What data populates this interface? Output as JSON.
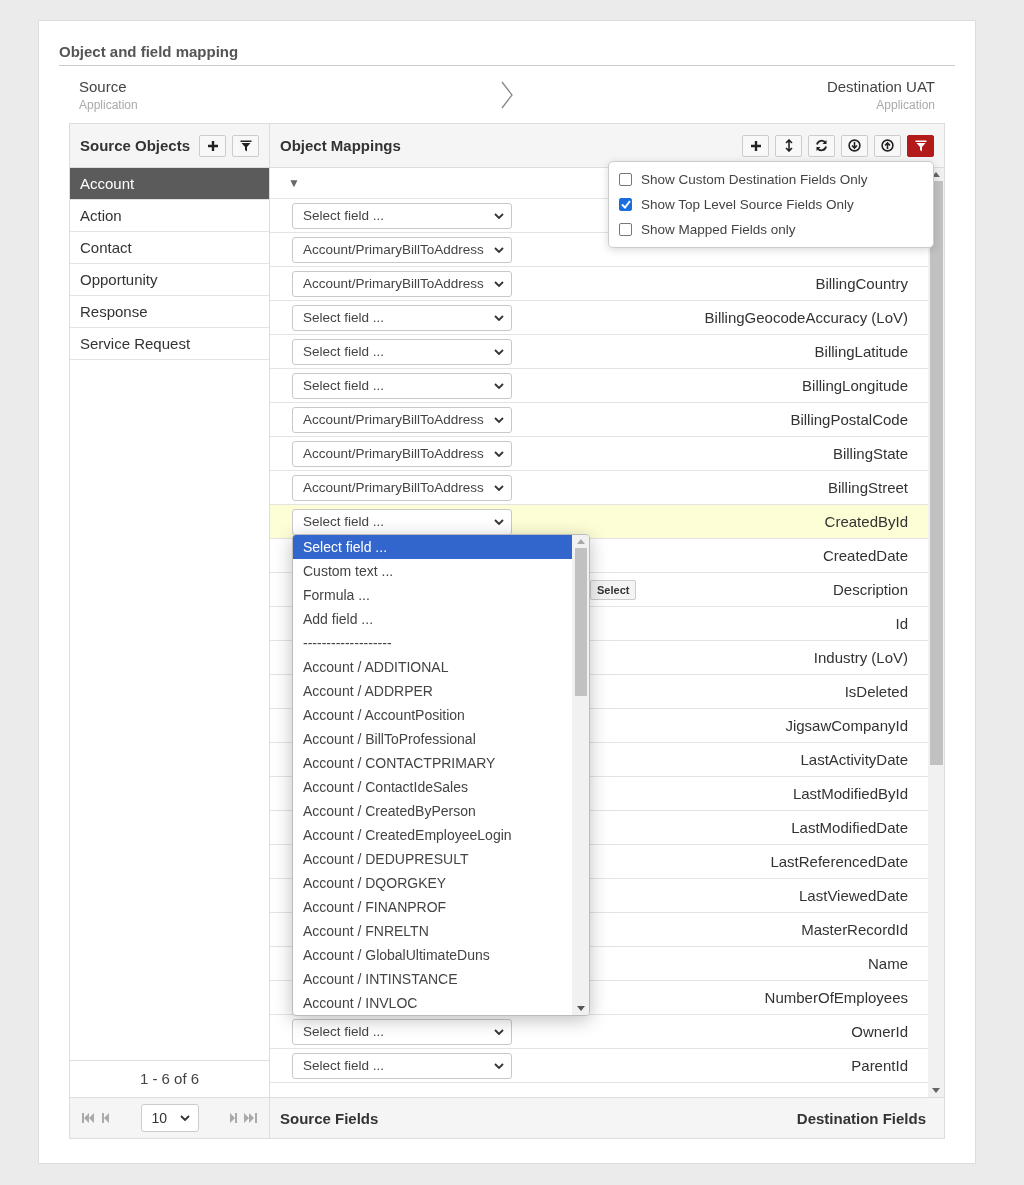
{
  "section_title": "Object and field mapping",
  "source": {
    "label": "Source",
    "sub": "Application"
  },
  "destination": {
    "label": "Destination UAT",
    "sub": "Application"
  },
  "source_objects": {
    "title": "Source Objects",
    "toolbar": [
      {
        "kind": "add"
      },
      {
        "kind": "filter"
      }
    ],
    "items": [
      {
        "label": "Account",
        "selected": true
      },
      {
        "label": "Action",
        "selected": false
      },
      {
        "label": "Contact",
        "selected": false
      },
      {
        "label": "Opportunity",
        "selected": false
      },
      {
        "label": "Response",
        "selected": false
      },
      {
        "label": "Service Request",
        "selected": false
      }
    ],
    "count": "1 - 6 of 6",
    "page_size": "10"
  },
  "mappings": {
    "title": "Object Mappings",
    "toolbar": [
      {
        "kind": "add",
        "active": false
      },
      {
        "kind": "expand",
        "active": false
      },
      {
        "kind": "refresh",
        "active": false
      },
      {
        "kind": "download",
        "active": false
      },
      {
        "kind": "upload",
        "active": false
      },
      {
        "kind": "filter",
        "active": true
      }
    ],
    "filter_menu": [
      {
        "label": "Show Custom Destination Fields Only",
        "checked": false
      },
      {
        "label": "Show Top Level Source Fields Only",
        "checked": true
      },
      {
        "label": "Show Mapped Fields only",
        "checked": false
      }
    ],
    "sort_mark": "▼",
    "rows": [
      {
        "source": "Select field ...",
        "selected": false
      },
      {
        "source": "Account/PrimaryBillToAddress",
        "selected": false
      },
      {
        "source": "Account/PrimaryBillToAddress",
        "destination": "BillingCountry",
        "selected": false
      },
      {
        "source": "Select field ...",
        "destination": "BillingGeocodeAccuracy (LoV)",
        "selected": false
      },
      {
        "source": "Select field ...",
        "destination": "BillingLatitude",
        "selected": false
      },
      {
        "source": "Select field ...",
        "destination": "BillingLongitude",
        "selected": false
      },
      {
        "source": "Account/PrimaryBillToAddress",
        "destination": "BillingPostalCode",
        "selected": false
      },
      {
        "source": "Account/PrimaryBillToAddress",
        "destination": "BillingState",
        "selected": false
      },
      {
        "source": "Account/PrimaryBillToAddress",
        "destination": "BillingStreet",
        "selected": false
      },
      {
        "source": "Select field ...",
        "destination": "CreatedById",
        "selected": true
      },
      {
        "destination": "CreatedDate",
        "selected": false
      },
      {
        "button": "Select",
        "destination": "Description",
        "selected": false
      },
      {
        "destination": "Id",
        "selected": false
      },
      {
        "destination": "Industry (LoV)",
        "selected": false
      },
      {
        "destination": "IsDeleted",
        "selected": false
      },
      {
        "destination": "JigsawCompanyId",
        "selected": false
      },
      {
        "destination": "LastActivityDate",
        "selected": false
      },
      {
        "destination": "LastModifiedById",
        "selected": false
      },
      {
        "destination": "LastModifiedDate",
        "selected": false
      },
      {
        "destination": "LastReferencedDate",
        "selected": false
      },
      {
        "destination": "LastViewedDate",
        "selected": false
      },
      {
        "destination": "MasterRecordId",
        "selected": false
      },
      {
        "destination": "Name",
        "selected": false
      },
      {
        "destination": "NumberOfEmployees",
        "selected": false
      },
      {
        "source": "Select field ...",
        "destination": "OwnerId",
        "selected": false
      },
      {
        "source": "Select field ...",
        "destination": "ParentId",
        "selected": false
      }
    ],
    "dropdown": [
      {
        "label": "Select field ...",
        "selected": true
      },
      {
        "label": "Custom text ...",
        "selected": false
      },
      {
        "label": "Formula ...",
        "selected": false
      },
      {
        "label": "Add field ...",
        "selected": false
      },
      {
        "label": "-------------------",
        "selected": false
      },
      {
        "label": "Account / ADDITIONAL",
        "selected": false
      },
      {
        "label": "Account / ADDRPER",
        "selected": false
      },
      {
        "label": "Account / AccountPosition",
        "selected": false
      },
      {
        "label": "Account / BillToProfessional",
        "selected": false
      },
      {
        "label": "Account / CONTACTPRIMARY",
        "selected": false
      },
      {
        "label": "Account / ContactIdeSales",
        "selected": false
      },
      {
        "label": "Account / CreatedByPerson",
        "selected": false
      },
      {
        "label": "Account / CreatedEmployeeLogin",
        "selected": false
      },
      {
        "label": "Account / DEDUPRESULT",
        "selected": false
      },
      {
        "label": "Account / DQORGKEY",
        "selected": false
      },
      {
        "label": "Account / FINANPROF",
        "selected": false
      },
      {
        "label": "Account / FNRELTN",
        "selected": false
      },
      {
        "label": "Account / GlobalUltimateDuns",
        "selected": false
      },
      {
        "label": "Account / INTINSTANCE",
        "selected": false
      },
      {
        "label": "Account / INVLOC",
        "selected": false
      }
    ],
    "footer_left": "Source Fields",
    "footer_right": "Destination Fields"
  }
}
